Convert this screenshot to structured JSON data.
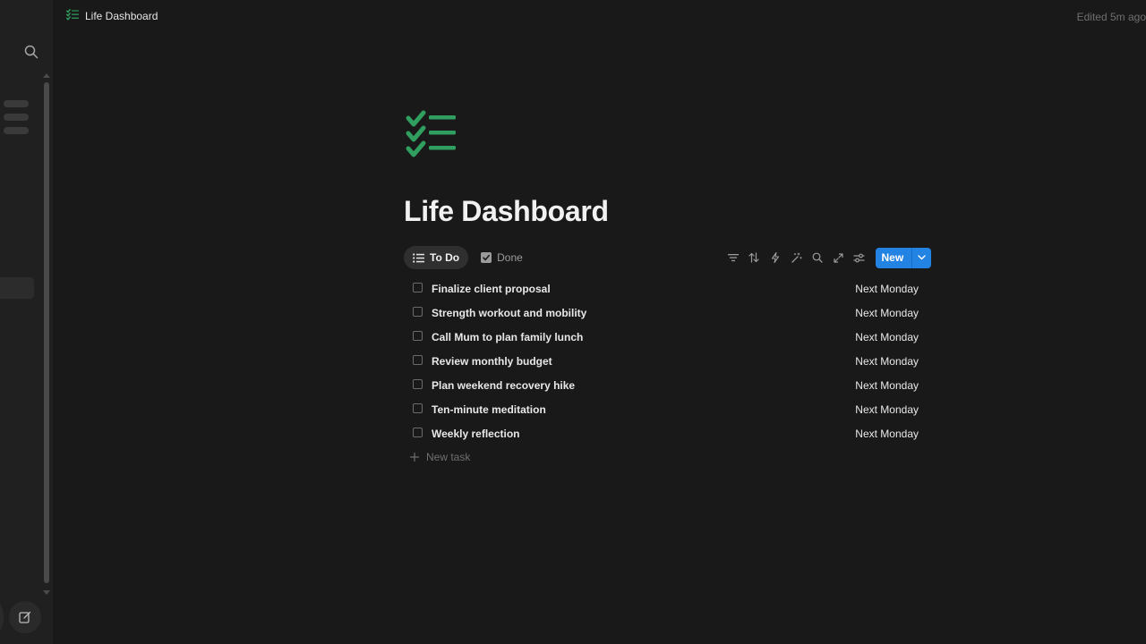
{
  "breadcrumb": {
    "title": "Life Dashboard"
  },
  "header": {
    "edited": "Edited 5m ago"
  },
  "page": {
    "title": "Life Dashboard"
  },
  "views": [
    {
      "label": "To Do",
      "icon": "list-icon",
      "active": true
    },
    {
      "label": "Done",
      "icon": "checkbox-checked-icon",
      "active": false
    }
  ],
  "toolbar": {
    "icons": [
      "filter-icon",
      "sort-icon",
      "automation-bolt-icon",
      "ai-sparkle-icon",
      "search-icon",
      "expand-icon",
      "settings-sliders-icon"
    ],
    "new_label": "New"
  },
  "tasks": [
    {
      "name": "Finalize client proposal",
      "date": "Next Monday",
      "done": false
    },
    {
      "name": "Strength workout and mobility",
      "date": "Next Monday",
      "done": false
    },
    {
      "name": "Call Mum to plan family lunch",
      "date": "Next Monday",
      "done": false
    },
    {
      "name": "Review monthly budget",
      "date": "Next Monday",
      "done": false
    },
    {
      "name": "Plan weekend recovery hike",
      "date": "Next Monday",
      "done": false
    },
    {
      "name": "Ten-minute meditation",
      "date": "Next Monday",
      "done": false
    },
    {
      "name": "Weekly reflection",
      "date": "Next Monday",
      "done": false
    }
  ],
  "new_task_label": "New task",
  "colors": {
    "accent": "#2383e2",
    "icon_green": "#2f9e5f",
    "background": "#191919",
    "sidebar": "#202020"
  }
}
